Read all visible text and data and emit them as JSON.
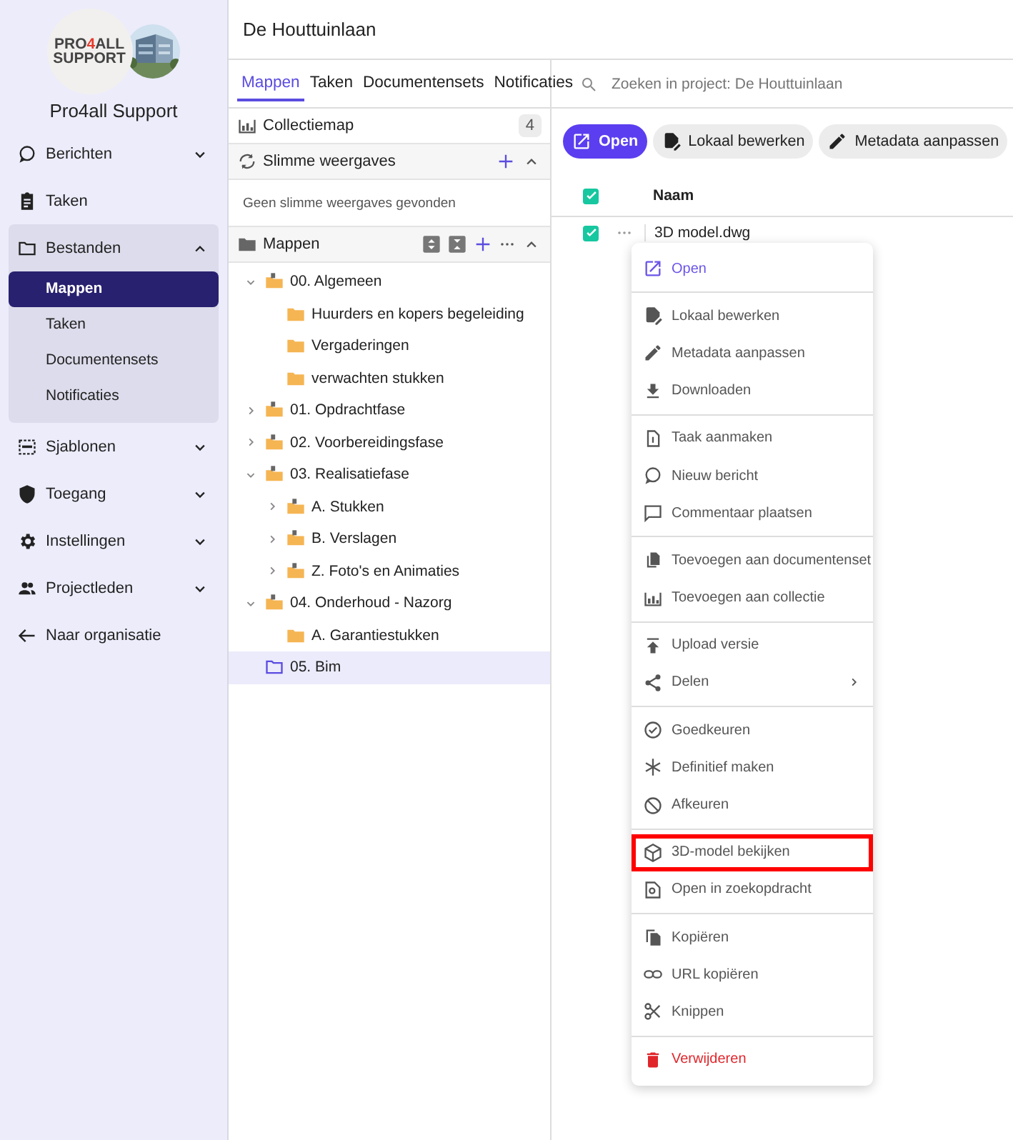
{
  "sidebar": {
    "logo": {
      "before": "PRO",
      "accent": "4",
      "after": "ALL",
      "line2": "SUPPORT"
    },
    "org_name": "Pro4all Support",
    "nav": [
      {
        "label": "Berichten",
        "kind": "group",
        "expanded": false
      },
      {
        "label": "Taken",
        "kind": "link"
      },
      {
        "label": "Bestanden",
        "kind": "group",
        "expanded": true,
        "children": [
          {
            "label": "Mappen",
            "selected": true
          },
          {
            "label": "Taken",
            "selected": false
          },
          {
            "label": "Documentensets",
            "selected": false
          },
          {
            "label": "Notificaties",
            "selected": false
          }
        ]
      },
      {
        "label": "Sjablonen",
        "kind": "group",
        "expanded": false
      },
      {
        "label": "Toegang",
        "kind": "group",
        "expanded": false
      },
      {
        "label": "Instellingen",
        "kind": "group",
        "expanded": false
      },
      {
        "label": "Projectleden",
        "kind": "group",
        "expanded": false
      },
      {
        "label": "Naar organisatie",
        "kind": "link"
      }
    ]
  },
  "header": {
    "title": "De Houttuinlaan"
  },
  "tabs": [
    {
      "label": "Mappen",
      "selected": true
    },
    {
      "label": "Taken",
      "selected": false
    },
    {
      "label": "Documentensets",
      "selected": false
    },
    {
      "label": "Notificaties",
      "selected": false
    }
  ],
  "search": {
    "placeholder": "Zoeken in project: De Houttuinlaan"
  },
  "panel": {
    "collection": {
      "label": "Collectiemap",
      "count": "4"
    },
    "smart_views": {
      "label": "Slimme weergaves",
      "expanded": true,
      "empty_text": "Geen slimme weergaves gevonden"
    },
    "folders": {
      "label": "Mappen",
      "expanded": true,
      "tree": [
        {
          "name": "00. Algemeen",
          "kind": "project",
          "expanded": true,
          "selected": false,
          "children": [
            {
              "name": "Huurders en kopers begeleiding",
              "kind": "plain",
              "selected": false
            },
            {
              "name": "Vergaderingen",
              "kind": "plain",
              "selected": false
            },
            {
              "name": "verwachten stukken",
              "kind": "plain",
              "selected": false
            }
          ]
        },
        {
          "name": "01. Opdrachtfase",
          "kind": "project",
          "expanded": false,
          "selected": false
        },
        {
          "name": "02. Voorbereidingsfase",
          "kind": "project",
          "expanded": false,
          "selected": false
        },
        {
          "name": "03. Realisatiefase",
          "kind": "project",
          "expanded": true,
          "selected": false,
          "children": [
            {
              "name": "A. Stukken",
              "kind": "project",
              "expanded": false,
              "selected": false
            },
            {
              "name": "B. Verslagen",
              "kind": "project",
              "expanded": false,
              "selected": false
            },
            {
              "name": "Z. Foto's en Animaties",
              "kind": "project",
              "expanded": false,
              "selected": false
            }
          ]
        },
        {
          "name": "04. Onderhoud - Nazorg",
          "kind": "project",
          "expanded": true,
          "selected": false,
          "children": [
            {
              "name": "A. Garantiestukken",
              "kind": "plain",
              "selected": false
            }
          ]
        },
        {
          "name": "05. Bim",
          "kind": "plain",
          "selected": true
        }
      ]
    }
  },
  "toolbar": [
    {
      "label": "Open",
      "kind": "primary"
    },
    {
      "label": "Lokaal bewerken",
      "kind": "secondary"
    },
    {
      "label": "Metadata aanpassen",
      "kind": "secondary"
    }
  ],
  "table": {
    "select_all": true,
    "columns": [
      "Naam"
    ],
    "rows": [
      {
        "name": "3D model.dwg",
        "checked": true
      }
    ]
  },
  "menu": {
    "groups": [
      [
        {
          "label": "Open",
          "kind": "accent"
        }
      ],
      [
        {
          "label": "Lokaal bewerken",
          "kind": "normal"
        },
        {
          "label": "Metadata aanpassen",
          "kind": "normal"
        },
        {
          "label": "Downloaden",
          "kind": "normal"
        }
      ],
      [
        {
          "label": "Taak aanmaken",
          "kind": "normal"
        },
        {
          "label": "Nieuw bericht",
          "kind": "normal"
        },
        {
          "label": "Commentaar plaatsen",
          "kind": "normal"
        }
      ],
      [
        {
          "label": "Toevoegen aan documentenset",
          "kind": "normal"
        },
        {
          "label": "Toevoegen aan collectie",
          "kind": "normal"
        }
      ],
      [
        {
          "label": "Upload versie",
          "kind": "normal"
        },
        {
          "label": "Delen",
          "kind": "submenu"
        }
      ],
      [
        {
          "label": "Goedkeuren",
          "kind": "normal"
        },
        {
          "label": "Definitief maken",
          "kind": "normal"
        },
        {
          "label": "Afkeuren",
          "kind": "normal"
        }
      ],
      [
        {
          "label": "3D-model bekijken",
          "kind": "normal",
          "highlighted": true
        },
        {
          "label": "Open in zoekopdracht",
          "kind": "normal"
        }
      ],
      [
        {
          "label": "Kopiëren",
          "kind": "normal"
        },
        {
          "label": "URL kopiëren",
          "kind": "normal"
        },
        {
          "label": "Knippen",
          "kind": "normal"
        }
      ],
      [
        {
          "label": "Verwijderen",
          "kind": "danger"
        }
      ]
    ]
  }
}
